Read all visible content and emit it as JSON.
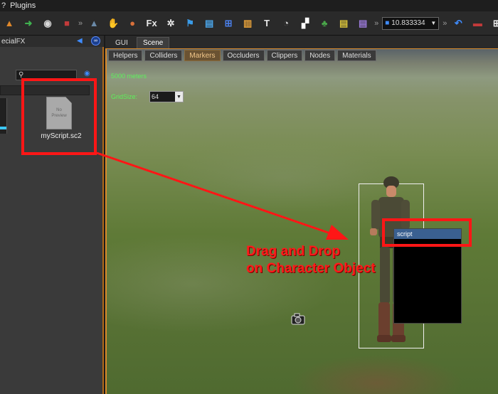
{
  "menubar": {
    "items": [
      "?",
      "Plugins"
    ]
  },
  "toolbar": {
    "sep_label": "»",
    "icons": [
      {
        "name": "terrain-icon",
        "glyph": "▲",
        "color": "#e0882a"
      },
      {
        "name": "export-icon",
        "glyph": "➜",
        "color": "#3fb14f"
      },
      {
        "name": "disc-icon",
        "glyph": "◉",
        "color": "#d8d8d8"
      },
      {
        "name": "cube-icon",
        "glyph": "■",
        "color": "#c23a3a"
      },
      {
        "name": "mountain-icon",
        "glyph": "▲",
        "color": "#6b8aa8"
      },
      {
        "name": "hand-icon",
        "glyph": "✋",
        "color": "#d8d8d8"
      },
      {
        "name": "sphere-icon",
        "glyph": "●",
        "color": "#d8703a"
      },
      {
        "name": "fx-icon",
        "glyph": "Fx",
        "color": "#e8e8e8"
      },
      {
        "name": "gear-wheel-icon",
        "glyph": "✲",
        "color": "#e8e8e8"
      },
      {
        "name": "flag-icon",
        "glyph": "⚑",
        "color": "#3a9be8"
      },
      {
        "name": "document-icon",
        "glyph": "▤",
        "color": "#4aa4e8"
      },
      {
        "name": "hierarchy-icon",
        "glyph": "⊞",
        "color": "#4a7fe8"
      },
      {
        "name": "notes-icon",
        "glyph": "▥",
        "color": "#e8a23a"
      },
      {
        "name": "text-icon",
        "glyph": "T",
        "color": "#e8e8e8"
      },
      {
        "name": "clock-icon",
        "glyph": "◔",
        "color": "#d8d8d8"
      },
      {
        "name": "checker-icon",
        "glyph": "▞",
        "color": "#ffffff"
      },
      {
        "name": "tree-icon",
        "glyph": "♣",
        "color": "#4aa84a"
      },
      {
        "name": "note-yellow-icon",
        "glyph": "▤",
        "color": "#d8c23a"
      },
      {
        "name": "page-icon",
        "glyph": "▤",
        "color": "#9a7ad8"
      }
    ],
    "combo_value": "10.833334",
    "right_icons": [
      {
        "name": "undo-icon",
        "glyph": "↶",
        "color": "#3f8cff"
      },
      {
        "name": "car-icon",
        "glyph": "▬",
        "color": "#c23a3a"
      },
      {
        "name": "grid-icon",
        "glyph": "⊞",
        "color": "#e8e8e8"
      }
    ]
  },
  "left_panel": {
    "header_label": "ecialFX",
    "collapse_glyph": "◀",
    "gear_glyph": "∞",
    "search_glyph": "⚲",
    "eye_glyph": "◉",
    "file_preview_line1": "No",
    "file_preview_line2": "Preview",
    "file_name": "myScript.sc2"
  },
  "viewport": {
    "tabs": [
      "GUI",
      "Scene"
    ],
    "buttons": [
      "Helpers",
      "Colliders",
      "Markers",
      "Occluders",
      "Clippers",
      "Nodes",
      "Materials"
    ],
    "active_button": "Markers",
    "distance": "5000 meters",
    "grid_label": "GridSize:",
    "grid_value": "64",
    "script_popup_title": "script"
  },
  "annotation": {
    "line1": "Drag and Drop",
    "line2": "on Character Object",
    "color": "#ff1616"
  }
}
